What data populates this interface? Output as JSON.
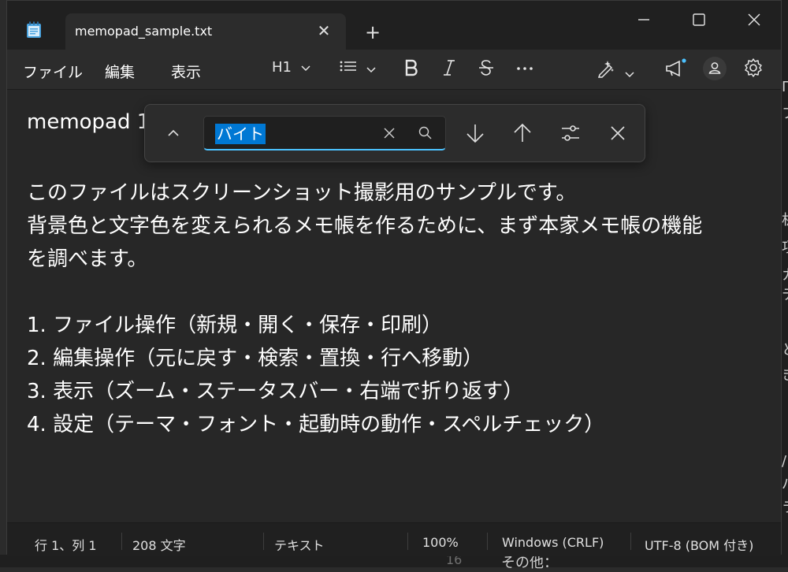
{
  "tab": {
    "title": "memopad_sample.txt"
  },
  "menu": {
    "file": "ファイル",
    "edit": "編集",
    "view": "表示"
  },
  "toolbar": {
    "heading": "H1"
  },
  "find": {
    "query": "バイト"
  },
  "editor": {
    "lines": [
      "memopad 1",
      "",
      "このファイルはスクリーンショット撮影用のサンプルです。",
      "背景色と文字色を変えられるメモ帳を作るために、まず本家メモ帳の機能",
      "を調べます。",
      "",
      "1. ファイル操作（新規・開く・保存・印刷）",
      "2. 編集操作（元に戻す・検索・置換・行へ移動）",
      "3. 表示（ズーム・ステータスバー・右端で折り返す）",
      "4. 設定（テーマ・フォント・起動時の動作・スペルチェック）"
    ]
  },
  "status": {
    "position": "行 1、列 1",
    "chars": "208 文字",
    "format": "テキスト",
    "zoom": "100%",
    "line_ending": "Windows (CRLF)",
    "encoding": "UTF-8 (BOM 付き)"
  },
  "background": {
    "peek_chars": [
      "П",
      "フ",
      "机",
      "項",
      "カ",
      "テ",
      "と",
      "き",
      "/",
      "パ",
      "ラ"
    ],
    "line_number": "16",
    "line_text": "その他："
  },
  "colors": {
    "accent": "#4cc2ff",
    "selection": "#0078d4",
    "editor_bg": "#272727"
  }
}
